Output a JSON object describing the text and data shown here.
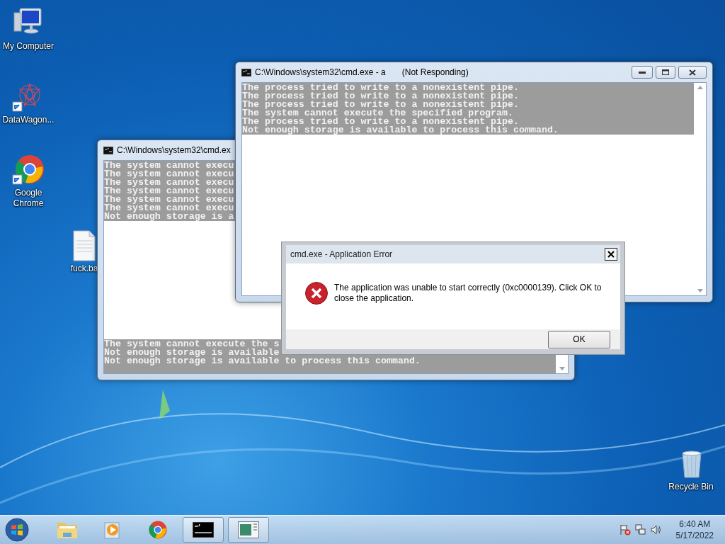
{
  "desktop_icons": [
    {
      "label": "My Computer",
      "kind": "computer",
      "shortcut": false
    },
    {
      "label": "DataWagon...",
      "kind": "star",
      "shortcut": true
    },
    {
      "label": "Google Chrome",
      "kind": "chrome",
      "shortcut": true
    },
    {
      "label": "fuck.ba",
      "kind": "file",
      "shortcut": false
    },
    {
      "label": "Recycle Bin",
      "kind": "bin",
      "shortcut": false
    }
  ],
  "console_windows": [
    {
      "title": "C:\\Windows\\system32\\cmd.ex",
      "top_lines": [
        "The system cannot execu",
        "The system cannot execu",
        "The system cannot execu",
        "The system cannot execu",
        "The system cannot execu",
        "The system cannot execu",
        "Not enough storage is a"
      ],
      "bottom_lines": [
        "The system cannot execute the s",
        "Not enough storage is available",
        "Not enough storage is available to process this command."
      ]
    },
    {
      "title": "C:\\Windows\\system32\\cmd.exe - a",
      "status": "(Not Responding)",
      "top_lines": [
        "The process tried to write to a nonexistent pipe.",
        "The process tried to write to a nonexistent pipe.",
        "The process tried to write to a nonexistent pipe.",
        "The system cannot execute the specified program.",
        "The process tried to write to a nonexistent pipe.",
        "Not enough storage is available to process this command."
      ]
    }
  ],
  "dialog": {
    "title": "cmd.exe - Application Error",
    "message": "The application was unable to start correctly (0xc0000139). Click OK to close the application.",
    "button": "OK"
  },
  "taskbar": {
    "items": [
      {
        "kind": "folder",
        "open": false
      },
      {
        "kind": "media",
        "open": false
      },
      {
        "kind": "chrome",
        "open": false
      },
      {
        "kind": "console",
        "open": true
      },
      {
        "kind": "window",
        "open": true
      }
    ],
    "tray_icons": [
      {
        "kind": "flag"
      },
      {
        "kind": "network"
      },
      {
        "kind": "speaker"
      }
    ],
    "time": "6:40 AM",
    "date": "5/17/2022"
  }
}
